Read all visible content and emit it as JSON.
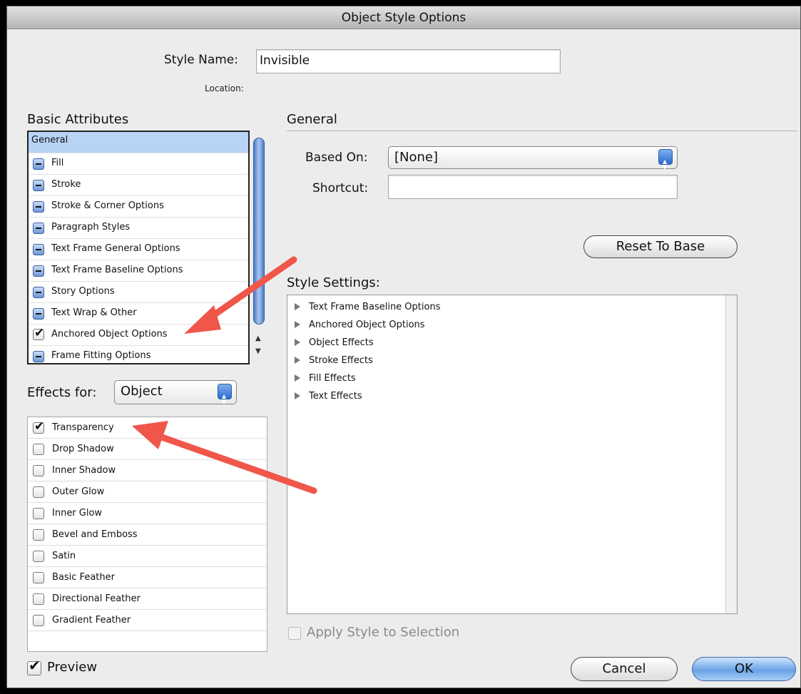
{
  "window": {
    "title": "Object Style Options"
  },
  "style_name": {
    "label": "Style Name:",
    "value": "Invisible",
    "location_label": "Location:"
  },
  "basic_attributes": {
    "heading": "Basic Attributes",
    "items": [
      {
        "label": "General",
        "state": "selected"
      },
      {
        "label": "Fill",
        "state": "mixed"
      },
      {
        "label": "Stroke",
        "state": "mixed"
      },
      {
        "label": "Stroke & Corner Options",
        "state": "mixed"
      },
      {
        "label": "Paragraph Styles",
        "state": "mixed"
      },
      {
        "label": "Text Frame General Options",
        "state": "mixed"
      },
      {
        "label": "Text Frame Baseline Options",
        "state": "mixed"
      },
      {
        "label": "Story Options",
        "state": "mixed"
      },
      {
        "label": "Text Wrap & Other",
        "state": "mixed"
      },
      {
        "label": "Anchored Object Options",
        "state": "checked"
      },
      {
        "label": "Frame Fitting Options",
        "state": "mixed"
      }
    ]
  },
  "effects_for": {
    "label": "Effects for:",
    "value": "Object"
  },
  "effects": [
    {
      "label": "Transparency",
      "checked": true
    },
    {
      "label": "Drop Shadow",
      "checked": false
    },
    {
      "label": "Inner Shadow",
      "checked": false
    },
    {
      "label": "Outer Glow",
      "checked": false
    },
    {
      "label": "Inner Glow",
      "checked": false
    },
    {
      "label": "Bevel and Emboss",
      "checked": false
    },
    {
      "label": "Satin",
      "checked": false
    },
    {
      "label": "Basic Feather",
      "checked": false
    },
    {
      "label": "Directional Feather",
      "checked": false
    },
    {
      "label": "Gradient Feather",
      "checked": false
    }
  ],
  "general": {
    "heading": "General",
    "based_on_label": "Based On:",
    "based_on_value": "[None]",
    "shortcut_label": "Shortcut:",
    "shortcut_value": "",
    "reset_button": "Reset To Base"
  },
  "style_settings": {
    "heading": "Style Settings:",
    "items": [
      "Text Frame Baseline Options",
      "Anchored Object Options",
      "Object Effects",
      "Stroke Effects",
      "Fill Effects",
      "Text Effects"
    ]
  },
  "apply_to_selection": {
    "label": "Apply Style to Selection",
    "checked": false,
    "enabled": false
  },
  "preview": {
    "label": "Preview",
    "checked": true
  },
  "buttons": {
    "cancel": "Cancel",
    "ok": "OK"
  },
  "colors": {
    "selection": "#b9d3f5",
    "default_button": "#6aa3e6",
    "annotation_arrow": "#f0564a"
  },
  "icons": {
    "mixed_state": "minus-box-icon",
    "checked_state": "checkmark-icon",
    "disclosure": "disclosure-triangle-icon"
  }
}
